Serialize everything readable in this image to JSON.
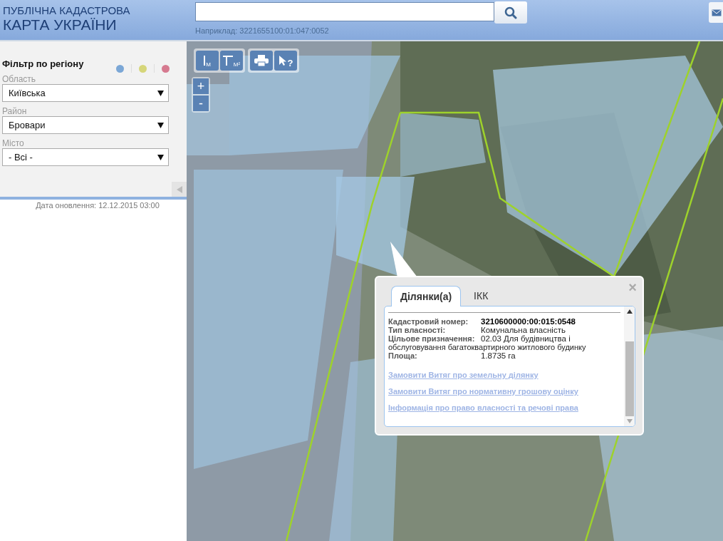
{
  "header": {
    "title_line1": "ПУБЛІЧНА КАДАСТРОВА",
    "title_line2": "КАРТА УКРАЇНИ",
    "search": {
      "hint": "Наприклад: 3221655100:01:047:0052"
    }
  },
  "sidebar": {
    "title": "Фільтр по регіону",
    "layers": [
      {
        "color": "#7ba7d6"
      },
      {
        "color": "#d6d67a"
      },
      {
        "color": "#d67a90"
      }
    ],
    "filters": [
      {
        "label": "Область",
        "value": "Київська"
      },
      {
        "label": "Район",
        "value": "Бровари"
      },
      {
        "label": "Місто",
        "value": "- Всі -"
      }
    ],
    "update_date": "Дата оновлення: 12.12.2015 03:00"
  },
  "map": {
    "kind": "picture",
    "tools": [
      {
        "kind": "length",
        "label": "М"
      },
      {
        "kind": "area",
        "label": "М²"
      },
      {
        "kind": "print"
      },
      {
        "kind": "identify",
        "label": "?"
      }
    ],
    "zoom": [
      "+",
      "-"
    ]
  },
  "popup": {
    "tabs": [
      {
        "label": "Ділянки(а)",
        "selected": true
      },
      {
        "label": "ІКК",
        "selected": false
      }
    ],
    "close": "×",
    "fields": [
      {
        "label": "Кадастровий номер:",
        "value": "3210600000:00:015:0548",
        "bold": true
      },
      {
        "label": "Тип власності:",
        "value": "Комунальна власність",
        "bold": false
      },
      {
        "label": "Цільове призначення:",
        "value": "02.03 Для будівництва і",
        "continuation": "обслуговування багатоквартирного житлового будинку",
        "bold": false
      },
      {
        "label": "Площа:",
        "value": "1.8735 га",
        "bold": false
      }
    ],
    "links": [
      "Замовити Витяг про земельну ділянку",
      "Замовити Витяг про нормативну грошову оцінку",
      "Інформація про право власності та речові права"
    ]
  }
}
